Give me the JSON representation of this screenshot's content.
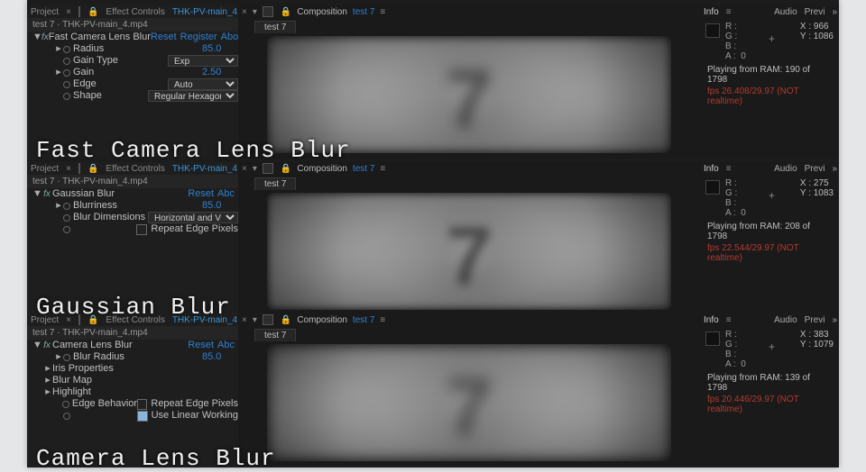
{
  "rows": [
    {
      "overlay_title": "Fast Camera Lens Blur",
      "left": {
        "tabs": {
          "project": "Project",
          "fxctl": "Effect Controls",
          "clip": "THK-PV-main_4.",
          "close": "×"
        },
        "crumb": "test 7 · THK-PV-main_4.mp4",
        "fx_head": {
          "name": "Fast Camera Lens Blur",
          "reset": "Reset",
          "register": "Register",
          "about": "Abot"
        },
        "params": [
          {
            "label": "Radius",
            "value": "85.0",
            "kind": "num"
          },
          {
            "label": "Gain Type",
            "value": "Exp",
            "kind": "dd"
          },
          {
            "label": "Gain",
            "value": "2.50",
            "kind": "num"
          },
          {
            "label": "Edge",
            "value": "Auto",
            "kind": "dd"
          },
          {
            "label": "Shape",
            "value": "Regular Hexagon",
            "kind": "dd-wide"
          }
        ]
      },
      "mid": {
        "tabs": {
          "comp": "Composition",
          "compname": "test 7",
          "tri": "≡",
          "close": "×"
        },
        "viewer_tab": "test 7"
      },
      "right": {
        "tabs": {
          "info": "Info",
          "menu": "≡",
          "audio": "Audio",
          "previ": "Previ",
          "rchev": "»"
        },
        "rgba": {
          "r": "R :",
          "g": "G :",
          "b": "B :",
          "a": "A :",
          "a_val": "0"
        },
        "coords": {
          "x": "X : 966",
          "y": "Y : 1086"
        },
        "ram": "Playing from RAM: 190 of 1798",
        "fps": "fps 26.408/29.97 (NOT realtime)"
      }
    },
    {
      "overlay_title": "Gaussian Blur",
      "left": {
        "tabs": {
          "project": "Project",
          "fxctl": "Effect Controls",
          "clip": "THK-PV-main_4.",
          "close": "×"
        },
        "crumb": "test 7 · THK-PV-main_4.mp4",
        "fx_head": {
          "name": "Gaussian Blur",
          "reset": "Reset",
          "register": "",
          "about": "Abc"
        },
        "params": [
          {
            "label": "Blurriness",
            "value": "85.0",
            "kind": "num"
          },
          {
            "label": "Blur Dimensions",
            "value": "Horizontal and Verti",
            "kind": "dd-wide"
          },
          {
            "label": "Repeat Edge Pixels",
            "value": "",
            "kind": "checkbox-off",
            "indent": "ctrl-only"
          }
        ]
      },
      "mid": {
        "tabs": {
          "comp": "Composition",
          "compname": "test 7",
          "tri": "≡",
          "close": "×"
        },
        "viewer_tab": "test 7"
      },
      "right": {
        "tabs": {
          "info": "Info",
          "menu": "≡",
          "audio": "Audio",
          "previ": "Previ",
          "rchev": "»"
        },
        "rgba": {
          "r": "R :",
          "g": "G :",
          "b": "B :",
          "a": "A :",
          "a_val": "0"
        },
        "coords": {
          "x": "X : 275",
          "y": "Y : 1083"
        },
        "ram": "Playing from RAM: 208 of 1798",
        "fps": "fps 22.544/29.97 (NOT realtime)"
      }
    },
    {
      "overlay_title": "Camera Lens Blur",
      "left": {
        "tabs": {
          "project": "Project",
          "fxctl": "Effect Controls",
          "clip": "THK-PV-main_4.",
          "close": "×"
        },
        "crumb": "test 7 · THK-PV-main_4.mp4",
        "fx_head": {
          "name": "Camera Lens Blur",
          "reset": "Reset",
          "register": "",
          "about": "Abc"
        },
        "params": [
          {
            "label": "Blur Radius",
            "value": "85.0",
            "kind": "num"
          },
          {
            "label": "Iris Properties",
            "value": "",
            "kind": "group"
          },
          {
            "label": "Blur Map",
            "value": "",
            "kind": "group"
          },
          {
            "label": "Highlight",
            "value": "",
            "kind": "group"
          },
          {
            "label": "Edge Behavior",
            "value": "Repeat Edge Pixels",
            "kind": "checkbox-off-label"
          },
          {
            "label": "",
            "value": "Use Linear Working",
            "kind": "checkbox-on-label"
          }
        ]
      },
      "mid": {
        "tabs": {
          "comp": "Composition",
          "compname": "test 7",
          "tri": "≡",
          "close": "×"
        },
        "viewer_tab": "test 7"
      },
      "right": {
        "tabs": {
          "info": "Info",
          "menu": "≡",
          "audio": "Audio",
          "previ": "Previ",
          "rchev": "»"
        },
        "rgba": {
          "r": "R :",
          "g": "G :",
          "b": "B :",
          "a": "A :",
          "a_val": "0"
        },
        "coords": {
          "x": "X : 383",
          "y": "Y : 1079"
        },
        "ram": "Playing from RAM: 139 of 1798",
        "fps": "fps 20.446/29.97 (NOT realtime)"
      }
    }
  ]
}
